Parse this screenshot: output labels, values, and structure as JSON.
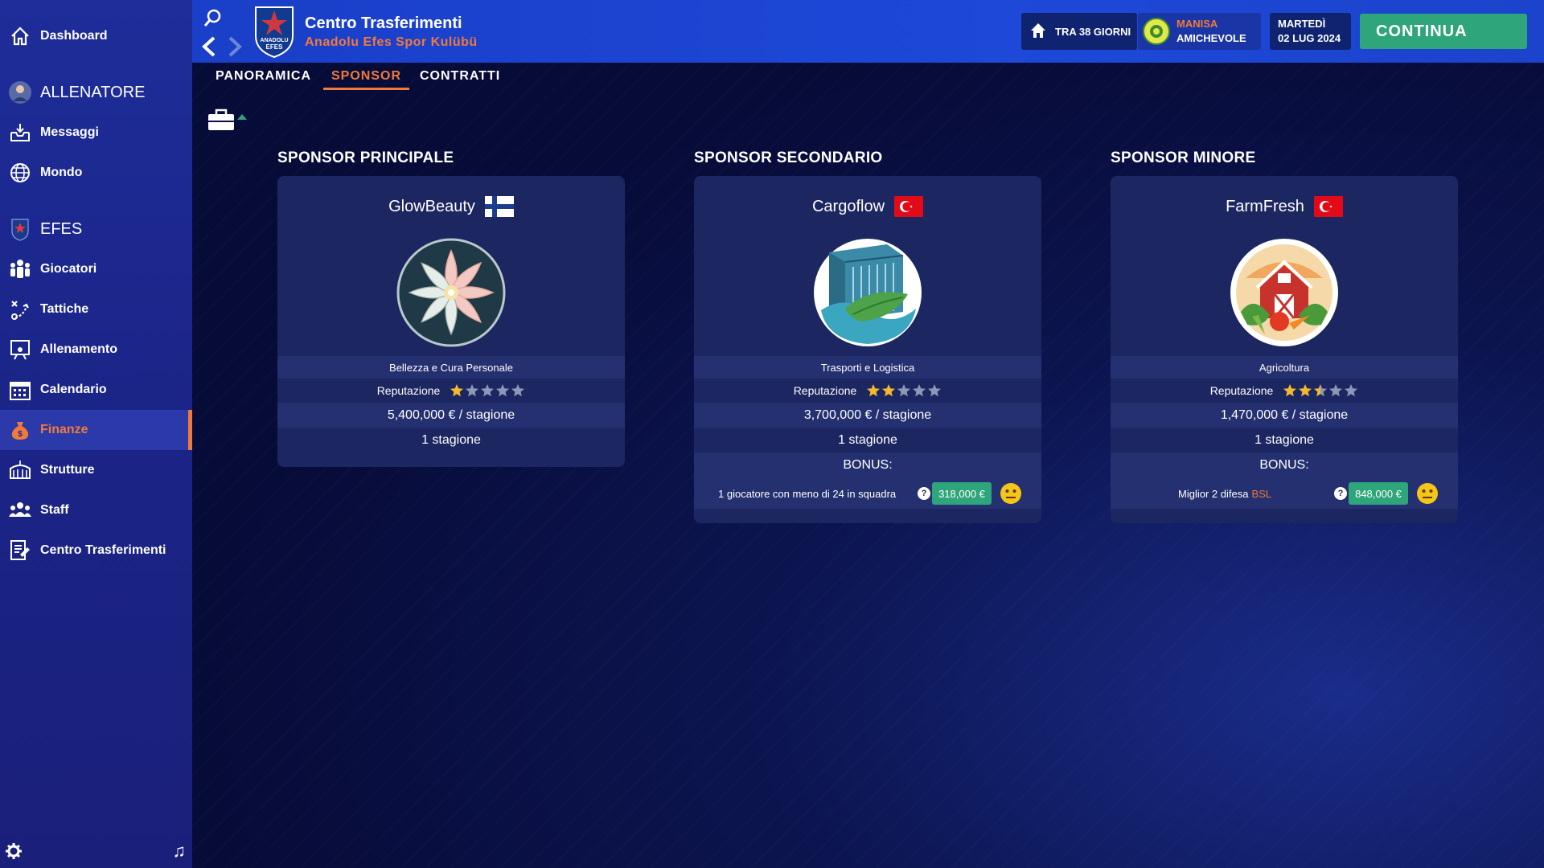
{
  "sidebar": {
    "items": [
      {
        "label": "Dashboard",
        "icon": "home-icon"
      },
      {
        "label": "ALLENATORE",
        "icon": "coach-avatar"
      },
      {
        "label": "Messaggi",
        "icon": "inbox-icon"
      },
      {
        "label": "Mondo",
        "icon": "globe-icon"
      },
      {
        "label": "EFES",
        "icon": "team-crest-icon"
      },
      {
        "label": "Giocatori",
        "icon": "players-icon"
      },
      {
        "label": "Tattiche",
        "icon": "tactics-icon"
      },
      {
        "label": "Allenamento",
        "icon": "training-board-icon"
      },
      {
        "label": "Calendario",
        "icon": "calendar-icon"
      },
      {
        "label": "Finanze",
        "icon": "money-bag-icon",
        "active": true
      },
      {
        "label": "Strutture",
        "icon": "stadium-icon"
      },
      {
        "label": "Staff",
        "icon": "staff-icon"
      },
      {
        "label": "Centro Trasferimenti",
        "icon": "transfer-doc-icon"
      }
    ],
    "accent_color": "#f07a3c"
  },
  "header": {
    "title": "Centro Trasferimenti",
    "subtitle": "Anadolu Efes Spor Kulübü",
    "crest_lines": [
      "ANADOLU",
      "EFES"
    ],
    "next_home": "TRA 38 GIORNI",
    "opponent": "MANISA",
    "match_type": "AMICHEVOLE",
    "day": "MARTEDÌ",
    "date": "02 LUG 2024",
    "continue_label": "CONTINUA"
  },
  "tabs": [
    {
      "label": "PANORAMICA",
      "active": false
    },
    {
      "label": "SPONSOR",
      "active": true
    },
    {
      "label": "CONTRATTI",
      "active": false
    }
  ],
  "sponsors": [
    {
      "heading": "SPONSOR PRINCIPALE",
      "name": "GlowBeauty",
      "flag": "Finland",
      "industry": "Bellezza e Cura Personale",
      "rep_label": "Reputazione",
      "stars": 1,
      "amount": "5,400,000 € / stagione",
      "duration": "1 stagione"
    },
    {
      "heading": "SPONSOR SECONDARIO",
      "name": "Cargoflow",
      "flag": "Turkey",
      "industry": "Trasporti e Logistica",
      "rep_label": "Reputazione",
      "stars": 2,
      "amount": "3,700,000 € / stagione",
      "duration": "1 stagione",
      "bonus_label": "BONUS:",
      "bonus_text": "1 giocatore con meno di 24 in squadra",
      "bonus_amount": "318,000 €"
    },
    {
      "heading": "SPONSOR MINORE",
      "name": "FarmFresh",
      "flag": "Turkey",
      "industry": "Agricoltura",
      "rep_label": "Reputazione",
      "stars": 2.5,
      "amount": "1,470,000 € / stagione",
      "duration": "1 stagione",
      "bonus_label": "BONUS:",
      "bonus_text": "Miglior 2 difesa",
      "bonus_highlight": "BSL",
      "bonus_amount": "848,000 €"
    }
  ]
}
